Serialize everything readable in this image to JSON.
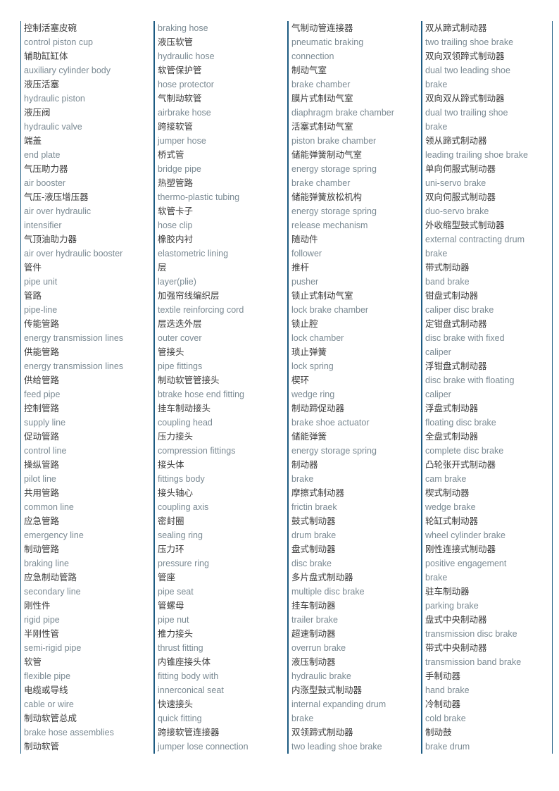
{
  "document": {
    "type": "bilingual-glossary",
    "subject": "Automotive braking system terminology",
    "colors": {
      "column_rule": "#1d5b82",
      "chinese_text": "#3a3a3a",
      "english_text": "#7b8a93",
      "background": "#ffffff"
    }
  },
  "columns": [
    {
      "id": "column-1",
      "lines": [
        {
          "lang": "zh",
          "text": "控制活塞皮碗"
        },
        {
          "lang": "en",
          "text": "control piston cup"
        },
        {
          "lang": "zh",
          "text": "辅助缸缸体"
        },
        {
          "lang": "en",
          "text": "auxiliary cylinder body"
        },
        {
          "lang": "zh",
          "text": "液压活塞"
        },
        {
          "lang": "en",
          "text": "hydraulic piston"
        },
        {
          "lang": "zh",
          "text": "液压阀"
        },
        {
          "lang": "en",
          "text": "hydraulic valve"
        },
        {
          "lang": "zh",
          "text": "端盖"
        },
        {
          "lang": "en",
          "text": "end plate"
        },
        {
          "lang": "zh",
          "text": "气压助力器"
        },
        {
          "lang": "en",
          "text": "air booster"
        },
        {
          "lang": "zh",
          "text": "气压-液压增压器"
        },
        {
          "lang": "en",
          "text": "air over hydraulic"
        },
        {
          "lang": "en",
          "text": "intensifier"
        },
        {
          "lang": "zh",
          "text": "气顶油助力器"
        },
        {
          "lang": "en",
          "text": "air over hydraulic booster"
        },
        {
          "lang": "zh",
          "text": "管件"
        },
        {
          "lang": "en",
          "text": "pipe unit"
        },
        {
          "lang": "zh",
          "text": "管路"
        },
        {
          "lang": "en",
          "text": "pipe-line"
        },
        {
          "lang": "zh",
          "text": "传能管路"
        },
        {
          "lang": "en",
          "text": "energy transmission lines"
        },
        {
          "lang": "zh",
          "text": "供能管路"
        },
        {
          "lang": "en",
          "text": "energy transmission lines"
        },
        {
          "lang": "zh",
          "text": "供给管路"
        },
        {
          "lang": "en",
          "text": "feed pipe"
        },
        {
          "lang": "zh",
          "text": "控制管路"
        },
        {
          "lang": "en",
          "text": "supply line"
        },
        {
          "lang": "zh",
          "text": "促动管路"
        },
        {
          "lang": "en",
          "text": "control line"
        },
        {
          "lang": "zh",
          "text": "操纵管路"
        },
        {
          "lang": "en",
          "text": "pilot line"
        },
        {
          "lang": "zh",
          "text": "共用管路"
        },
        {
          "lang": "en",
          "text": "common line"
        },
        {
          "lang": "zh",
          "text": "应急管路"
        },
        {
          "lang": "en",
          "text": "emergency line"
        },
        {
          "lang": "zh",
          "text": "制动管路"
        },
        {
          "lang": "en",
          "text": "braking line"
        },
        {
          "lang": "zh",
          "text": "应急制动管路"
        },
        {
          "lang": "en",
          "text": "secondary line"
        },
        {
          "lang": "zh",
          "text": "刚性件"
        },
        {
          "lang": "en",
          "text": "rigid pipe"
        },
        {
          "lang": "zh",
          "text": "半刚性管"
        },
        {
          "lang": "en",
          "text": "semi-rigid pipe"
        },
        {
          "lang": "zh",
          "text": "软管"
        },
        {
          "lang": "en",
          "text": "flexible pipe"
        },
        {
          "lang": "zh",
          "text": "电缆或导线"
        },
        {
          "lang": "en",
          "text": "cable or wire"
        },
        {
          "lang": "zh",
          "text": "制动软管总成"
        },
        {
          "lang": "en",
          "text": "brake hose assemblies"
        },
        {
          "lang": "zh",
          "text": "制动软管"
        }
      ]
    },
    {
      "id": "column-2",
      "lines": [
        {
          "lang": "en",
          "text": "braking hose"
        },
        {
          "lang": "zh",
          "text": "液压软管"
        },
        {
          "lang": "en",
          "text": "hydraulic hose"
        },
        {
          "lang": "zh",
          "text": "软管保护管"
        },
        {
          "lang": "en",
          "text": "hose protector"
        },
        {
          "lang": "zh",
          "text": "气制动软管"
        },
        {
          "lang": "en",
          "text": "airbrake hose"
        },
        {
          "lang": "zh",
          "text": "跨接软管"
        },
        {
          "lang": "en",
          "text": "jumper hose"
        },
        {
          "lang": "zh",
          "text": "桥式管"
        },
        {
          "lang": "en",
          "text": "bridge pipe"
        },
        {
          "lang": "zh",
          "text": "热塑管路"
        },
        {
          "lang": "en",
          "text": "thermo-plastic tubing"
        },
        {
          "lang": "zh",
          "text": "软管卡子"
        },
        {
          "lang": "en",
          "text": "hose clip"
        },
        {
          "lang": "zh",
          "text": "橡胶内衬"
        },
        {
          "lang": "en",
          "text": "elastometric lining"
        },
        {
          "lang": "zh",
          "text": "层"
        },
        {
          "lang": "en",
          "text": "layer(plie)"
        },
        {
          "lang": "zh",
          "text": "加强帘线编织层"
        },
        {
          "lang": "en",
          "text": "textile reinforcing cord"
        },
        {
          "lang": "zh",
          "text": "层迭迭外层"
        },
        {
          "lang": "en",
          "text": "outer cover"
        },
        {
          "lang": "zh",
          "text": "管接头"
        },
        {
          "lang": "en",
          "text": "pipe fittings"
        },
        {
          "lang": "zh",
          "text": "制动软管管接头"
        },
        {
          "lang": "en",
          "text": "btrake hose end fitting"
        },
        {
          "lang": "zh",
          "text": "挂车制动接头"
        },
        {
          "lang": "en",
          "text": "coupling head"
        },
        {
          "lang": "zh",
          "text": "压力接头"
        },
        {
          "lang": "en",
          "text": "compression fittings"
        },
        {
          "lang": "zh",
          "text": "接头体"
        },
        {
          "lang": "en",
          "text": "fittings body"
        },
        {
          "lang": "zh",
          "text": "接头轴心"
        },
        {
          "lang": "en",
          "text": "coupling axis"
        },
        {
          "lang": "zh",
          "text": "密封圈"
        },
        {
          "lang": "en",
          "text": "sealing ring"
        },
        {
          "lang": "zh",
          "text": "压力环"
        },
        {
          "lang": "en",
          "text": "pressure ring"
        },
        {
          "lang": "zh",
          "text": "管座"
        },
        {
          "lang": "en",
          "text": "pipe seat"
        },
        {
          "lang": "zh",
          "text": "管螺母"
        },
        {
          "lang": "en",
          "text": "pipe nut"
        },
        {
          "lang": "zh",
          "text": "推力接头"
        },
        {
          "lang": "en",
          "text": "thrust fitting"
        },
        {
          "lang": "zh",
          "text": "内锥座接头体"
        },
        {
          "lang": "en",
          "text": "fitting body with"
        },
        {
          "lang": "en",
          "text": "innerconical seat"
        },
        {
          "lang": "zh",
          "text": "快速接头"
        },
        {
          "lang": "en",
          "text": "quick fitting"
        },
        {
          "lang": "zh",
          "text": "跨接软管连接器"
        },
        {
          "lang": "en",
          "text": "jumper lose connection"
        }
      ]
    },
    {
      "id": "column-3",
      "lines": [
        {
          "lang": "zh",
          "text": "气制动管连接器"
        },
        {
          "lang": "en",
          "text": "pneumatic braking"
        },
        {
          "lang": "en",
          "text": "connection"
        },
        {
          "lang": "zh",
          "text": "制动气室"
        },
        {
          "lang": "en",
          "text": "brake chamber"
        },
        {
          "lang": "zh",
          "text": "膜片式制动气室"
        },
        {
          "lang": "en",
          "text": "diaphragm brake chamber"
        },
        {
          "lang": "zh",
          "text": "活塞式制动气室"
        },
        {
          "lang": "en",
          "text": "piston brake chamber"
        },
        {
          "lang": "zh",
          "text": "储能弹簧制动气室"
        },
        {
          "lang": "en",
          "text": "energy storage spring"
        },
        {
          "lang": "en",
          "text": "brake chamber"
        },
        {
          "lang": "zh",
          "text": "储能弹簧放松机构"
        },
        {
          "lang": "en",
          "text": "energy storage spring"
        },
        {
          "lang": "en",
          "text": "release mechanism"
        },
        {
          "lang": "zh",
          "text": "随动件"
        },
        {
          "lang": "en",
          "text": "follower"
        },
        {
          "lang": "zh",
          "text": "推杆"
        },
        {
          "lang": "en",
          "text": "pusher"
        },
        {
          "lang": "zh",
          "text": "锁止式制动气室"
        },
        {
          "lang": "en",
          "text": "lock brake chamber"
        },
        {
          "lang": "zh",
          "text": "锁止腔"
        },
        {
          "lang": "en",
          "text": "lock chamber"
        },
        {
          "lang": "zh",
          "text": "琐止弹簧"
        },
        {
          "lang": "en",
          "text": "lock spring"
        },
        {
          "lang": "zh",
          "text": "楔环"
        },
        {
          "lang": "en",
          "text": "wedge ring"
        },
        {
          "lang": "zh",
          "text": "制动蹄促动器"
        },
        {
          "lang": "en",
          "text": "brake shoe actuator"
        },
        {
          "lang": "zh",
          "text": "储能弹簧"
        },
        {
          "lang": "en",
          "text": "energy storage spring"
        },
        {
          "lang": "zh",
          "text": "制动器"
        },
        {
          "lang": "en",
          "text": "brake"
        },
        {
          "lang": "zh",
          "text": "摩擦式制动器"
        },
        {
          "lang": "en",
          "text": "frictin braek"
        },
        {
          "lang": "zh",
          "text": "鼓式制动器"
        },
        {
          "lang": "en",
          "text": "drum brake"
        },
        {
          "lang": "zh",
          "text": "盘式制动器"
        },
        {
          "lang": "en",
          "text": "disc brake"
        },
        {
          "lang": "zh",
          "text": "多片盘式制动器"
        },
        {
          "lang": "en",
          "text": "multiple disc brake"
        },
        {
          "lang": "zh",
          "text": "挂车制动器"
        },
        {
          "lang": "en",
          "text": "trailer brake"
        },
        {
          "lang": "zh",
          "text": "超速制动器"
        },
        {
          "lang": "en",
          "text": "overrun brake"
        },
        {
          "lang": "zh",
          "text": "液压制动器"
        },
        {
          "lang": "en",
          "text": "hydraulic brake"
        },
        {
          "lang": "zh",
          "text": "内涨型鼓式制动器"
        },
        {
          "lang": "en",
          "text": "internal expanding drum"
        },
        {
          "lang": "en",
          "text": "brake"
        },
        {
          "lang": "zh",
          "text": "双领蹄式制动器"
        },
        {
          "lang": "en",
          "text": "two leading shoe brake"
        }
      ]
    },
    {
      "id": "column-4",
      "lines": [
        {
          "lang": "zh",
          "text": "双从蹄式制动器"
        },
        {
          "lang": "en",
          "text": "two trailing shoe brake"
        },
        {
          "lang": "zh",
          "text": "双向双领蹄式制动器"
        },
        {
          "lang": "en",
          "text": "dual two leading shoe"
        },
        {
          "lang": "en",
          "text": "brake"
        },
        {
          "lang": "zh",
          "text": "双向双从蹄式制动器"
        },
        {
          "lang": "en",
          "text": "dual two trailing shoe"
        },
        {
          "lang": "en",
          "text": "brake"
        },
        {
          "lang": "zh",
          "text": "领从蹄式制动器"
        },
        {
          "lang": "en",
          "text": "leading trailing shoe brake"
        },
        {
          "lang": "zh",
          "text": "单向伺服式制动器"
        },
        {
          "lang": "en",
          "text": "uni-servo brake"
        },
        {
          "lang": "zh",
          "text": "双向伺服式制动器"
        },
        {
          "lang": "en",
          "text": "duo-servo brake"
        },
        {
          "lang": "zh",
          "text": "外收缩型鼓式制动器"
        },
        {
          "lang": "en",
          "text": "external contracting drum"
        },
        {
          "lang": "en",
          "text": "brake"
        },
        {
          "lang": "zh",
          "text": "带式制动器"
        },
        {
          "lang": "en",
          "text": "band brake"
        },
        {
          "lang": "zh",
          "text": "钳盘式制动器"
        },
        {
          "lang": "en",
          "text": "caliper disc brake"
        },
        {
          "lang": "zh",
          "text": "定钳盘式制动器"
        },
        {
          "lang": "en",
          "text": "disc brake with fixed"
        },
        {
          "lang": "en",
          "text": "caliper"
        },
        {
          "lang": "zh",
          "text": "浮钳盘式制动器"
        },
        {
          "lang": "en",
          "text": "disc brake with floating"
        },
        {
          "lang": "en",
          "text": "caliper"
        },
        {
          "lang": "zh",
          "text": "浮盘式制动器"
        },
        {
          "lang": "en",
          "text": "floating disc brake"
        },
        {
          "lang": "zh",
          "text": "全盘式制动器"
        },
        {
          "lang": "en",
          "text": "complete disc brake"
        },
        {
          "lang": "zh",
          "text": "凸轮张开式制动器"
        },
        {
          "lang": "en",
          "text": "cam brake"
        },
        {
          "lang": "zh",
          "text": "楔式制动器"
        },
        {
          "lang": "en",
          "text": "wedge brake"
        },
        {
          "lang": "zh",
          "text": "轮缸式制动器"
        },
        {
          "lang": "en",
          "text": "wheel cylinder brake"
        },
        {
          "lang": "zh",
          "text": "刚性连接式制动器"
        },
        {
          "lang": "en",
          "text": "positive engagement"
        },
        {
          "lang": "en",
          "text": "brake"
        },
        {
          "lang": "zh",
          "text": "驻车制动器"
        },
        {
          "lang": "en",
          "text": "parking brake"
        },
        {
          "lang": "zh",
          "text": "盘式中央制动器"
        },
        {
          "lang": "en",
          "text": "transmission disc brake"
        },
        {
          "lang": "zh",
          "text": "带式中央制动器"
        },
        {
          "lang": "en",
          "text": "transmission band brake"
        },
        {
          "lang": "zh",
          "text": "手制动器"
        },
        {
          "lang": "en",
          "text": "hand brake"
        },
        {
          "lang": "zh",
          "text": "冷制动器"
        },
        {
          "lang": "en",
          "text": "cold brake"
        },
        {
          "lang": "zh",
          "text": "制动鼓"
        },
        {
          "lang": "en",
          "text": "brake drum"
        }
      ]
    }
  ]
}
